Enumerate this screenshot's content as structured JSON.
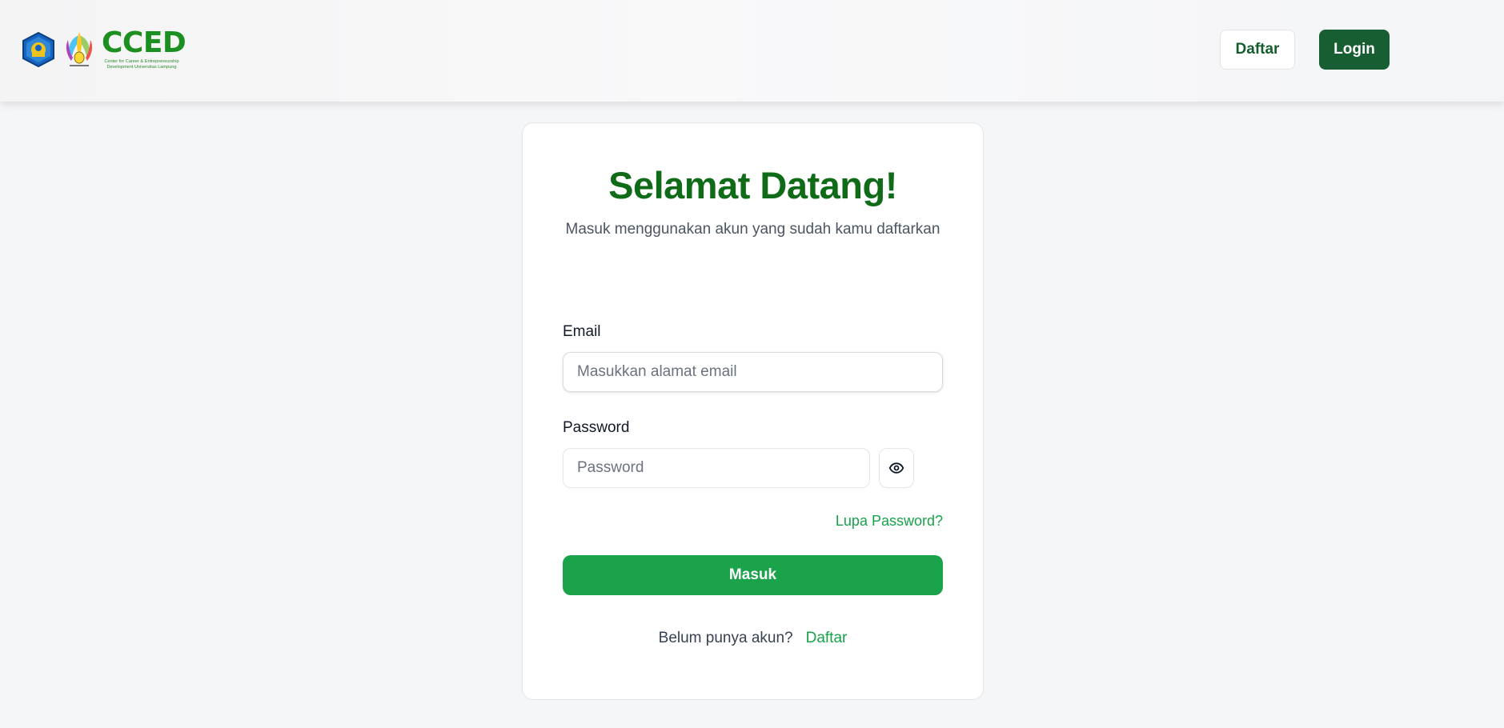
{
  "header": {
    "logo": {
      "wordmark": "CCED",
      "tagline": "Center for Career & Entrepreneurship Development Universitas Lampung",
      "brand_color": "#1c8f21"
    },
    "nav": {
      "daftar_label": "Daftar",
      "login_label": "Login"
    }
  },
  "login": {
    "title": "Selamat Datang!",
    "subtitle": "Masuk menggunakan akun yang sudah kamu daftarkan",
    "email": {
      "label": "Email",
      "value": "",
      "placeholder": "Masukkan alamat email"
    },
    "password": {
      "label": "Password",
      "value": "",
      "placeholder": "Password",
      "toggle_icon": "eye-icon"
    },
    "forgot_label": "Lupa Password?",
    "submit_label": "Masuk",
    "signup_prompt": "Belum punya akun?",
    "signup_link": "Daftar"
  },
  "colors": {
    "primary_dark": "#175e32",
    "primary": "#1aa34a",
    "title": "#0f6b18",
    "link": "#16a34a",
    "background": "#f5f6f8"
  }
}
